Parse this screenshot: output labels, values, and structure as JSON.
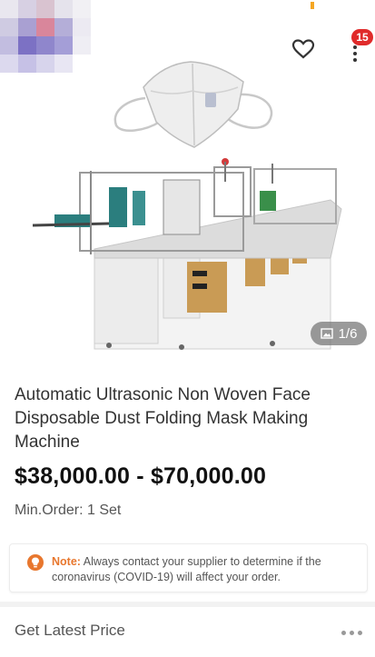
{
  "header": {
    "cart_badge": "15",
    "favorite_icon": "heart-outline-icon",
    "more_icon": "vertical-dots-icon"
  },
  "gallery": {
    "counter": "1/6",
    "counter_icon": "image-icon"
  },
  "product": {
    "title": "Automatic Ultrasonic Non Woven Face Disposable Dust Folding Mask Making Machine",
    "price": "$38,000.00 - $70,000.00",
    "min_order": "Min.Order: 1 Set"
  },
  "note": {
    "label": "Note:",
    "text": " Always contact your supplier to determine if the coronavirus (COVID-19) will affect your order.",
    "icon": "lightbulb-icon",
    "accent": "#e8772e"
  },
  "actions": {
    "latest_price": "Get Latest Price",
    "more_icon": "horizontal-dots-icon"
  },
  "colors": {
    "badge": "#e02b2b",
    "note_label": "#e8772e"
  }
}
